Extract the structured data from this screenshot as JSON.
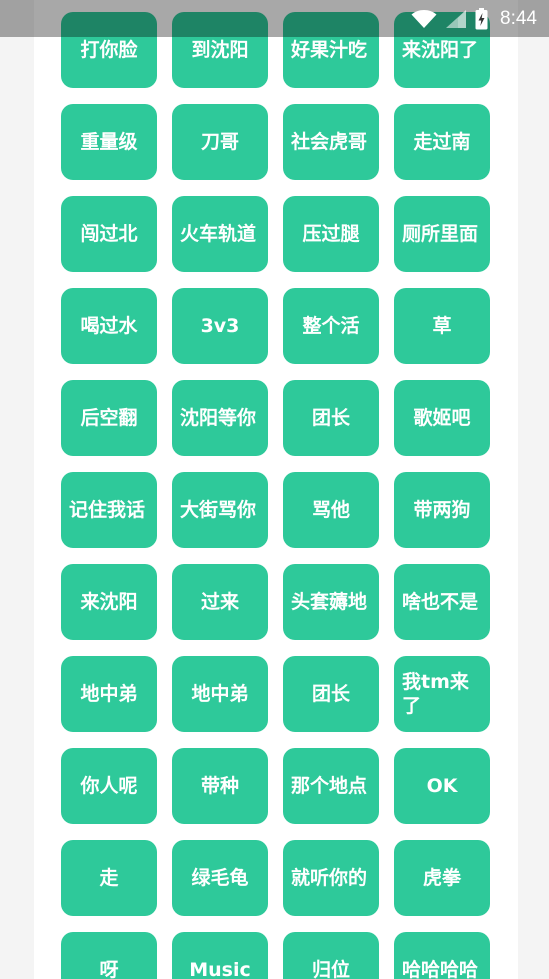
{
  "status_bar": {
    "time": "8:44",
    "icons": [
      "wifi-icon",
      "signal-icon",
      "battery-charging-icon"
    ]
  },
  "colors": {
    "button_bg": "#2ec99a",
    "button_text": "#ffffff",
    "status_overlay": "rgba(0,0,0,0.34)"
  },
  "buttons": [
    "打你脸",
    "到沈阳",
    "好果汁吃",
    "来沈阳了",
    "重量级",
    "刀哥",
    "社会虎哥",
    "走过南",
    "闯过北",
    "火车轨道",
    "压过腿",
    "厕所里面",
    "喝过水",
    "3v3",
    "整个活",
    "草",
    "后空翻",
    "沈阳等你",
    "团长",
    "歌姬吧",
    "记住我话",
    "大街骂你",
    "骂他",
    "带两狗",
    "来沈阳",
    "过来",
    "头套薅地",
    "啥也不是",
    "地中弟",
    "地中弟",
    "团长",
    "我tm来了",
    "你人呢",
    "带种",
    "那个地点",
    "OK",
    "走",
    "绿毛龟",
    "就听你的",
    "虎拳",
    "呀",
    "Music",
    "归位",
    "哈哈哈哈"
  ]
}
